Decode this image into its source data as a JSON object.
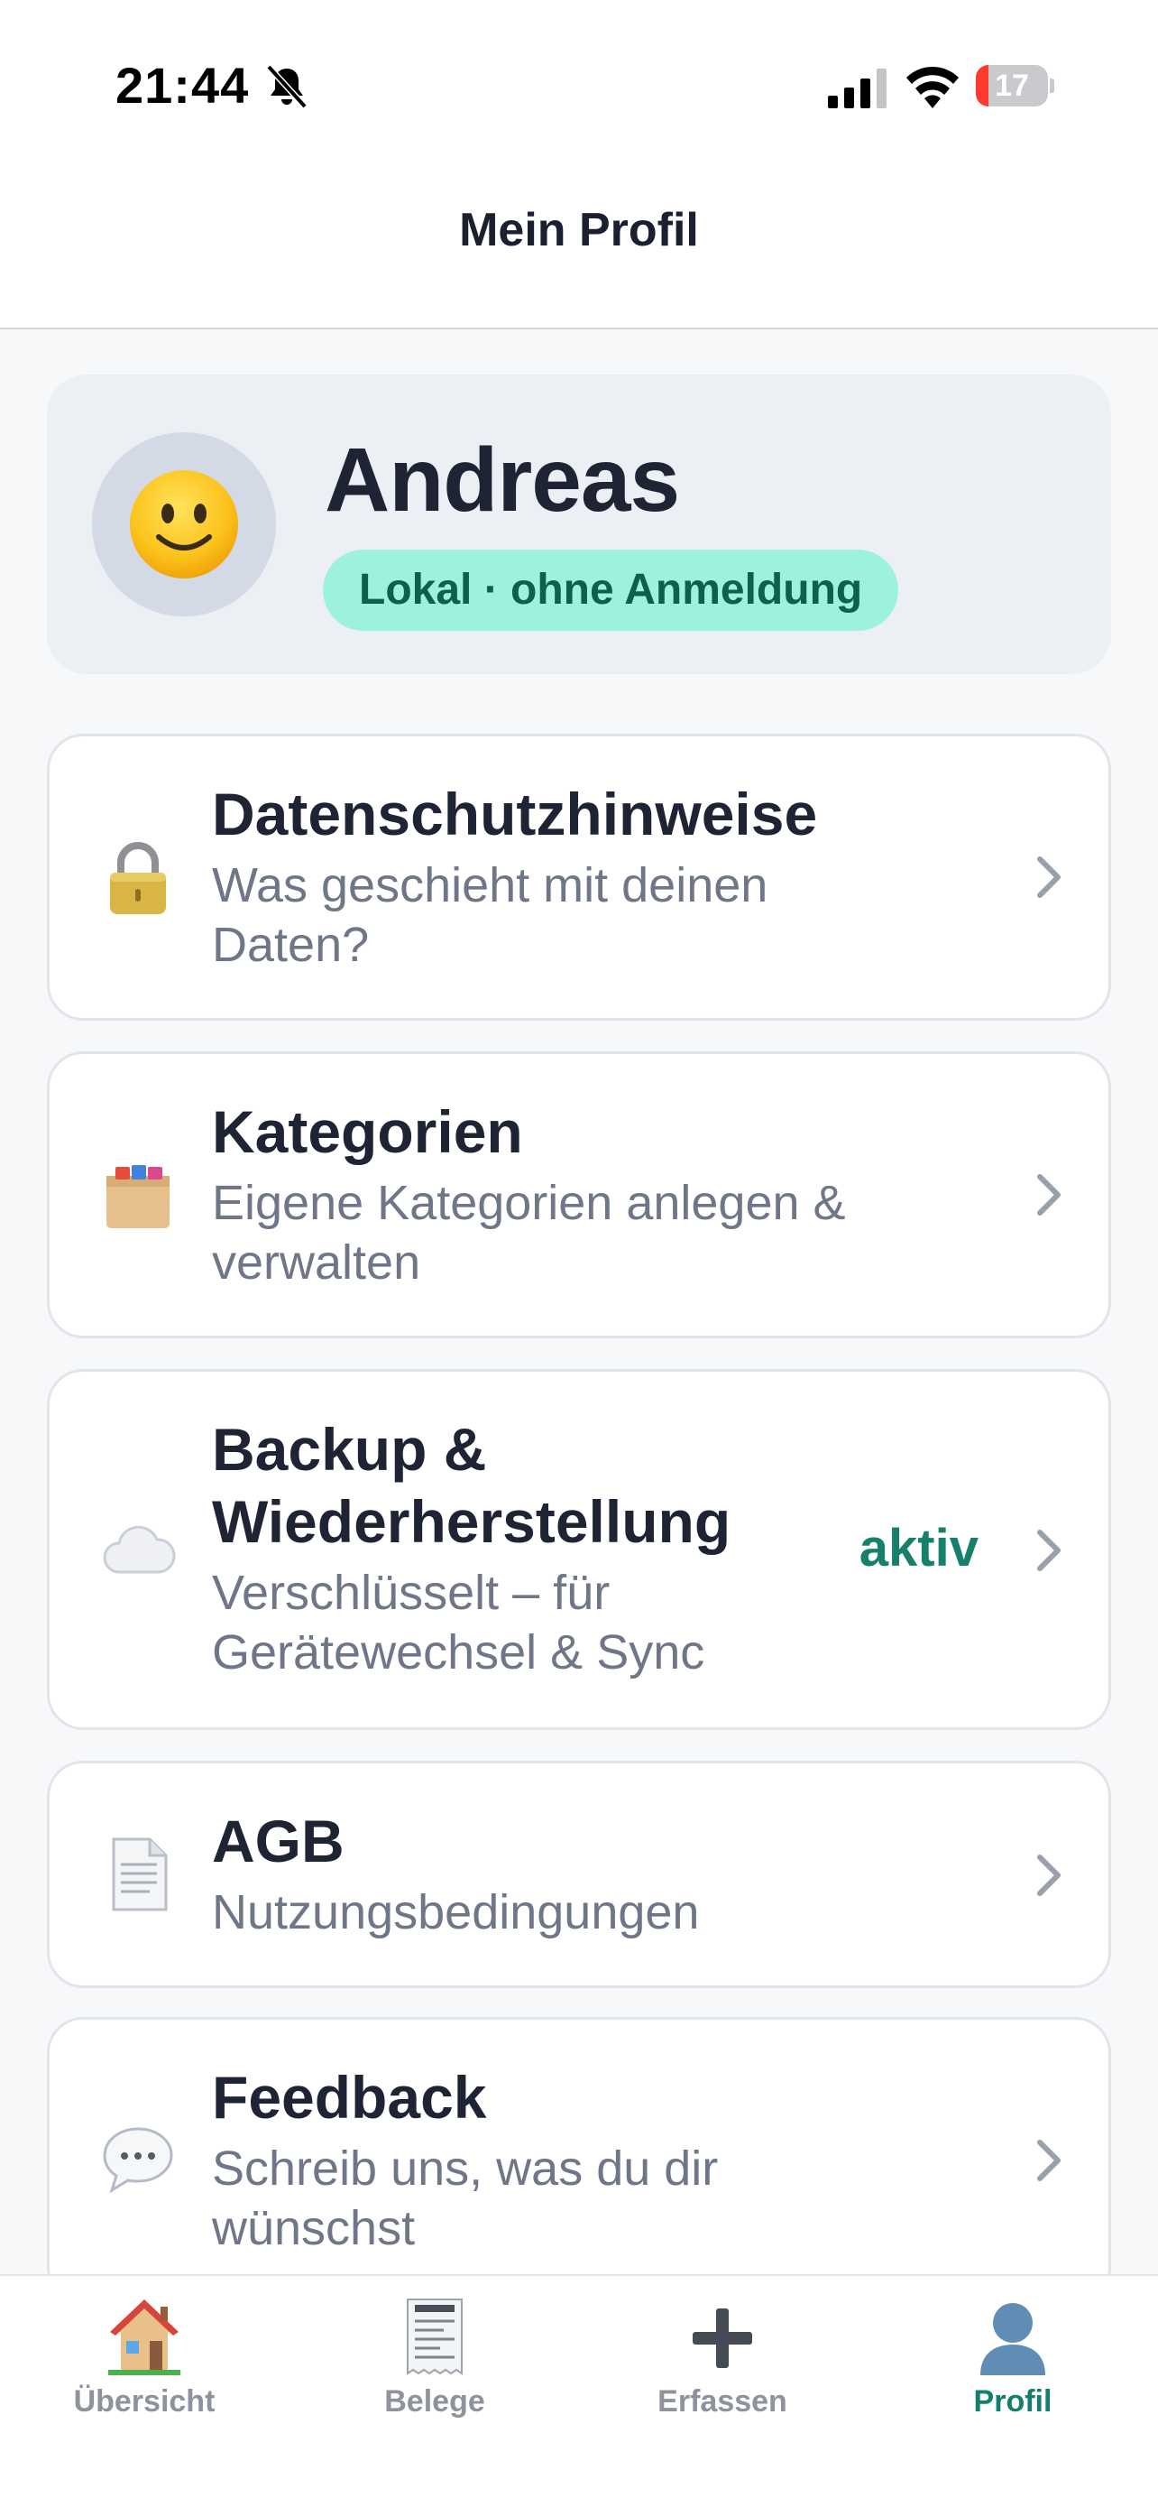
{
  "status_bar": {
    "time": "21:44",
    "battery_percent": "17",
    "battery_level": 0.17,
    "battery_color": "#ff3b30",
    "icons": [
      "bell-slash-icon",
      "cellular-signal-icon",
      "wifi-icon",
      "battery-icon"
    ]
  },
  "header": {
    "title": "Mein Profil"
  },
  "profile": {
    "avatar_icon": "smiling-face-icon",
    "name": "Andreas",
    "badge": "Lokal · ohne Anmeldung",
    "badge_color": "#9df2df"
  },
  "menu": {
    "items": [
      {
        "icon": "lock-icon",
        "title": "Datenschutzhinweise",
        "subtitle": "Was geschieht mit deinen Daten?"
      },
      {
        "icon": "card-file-box-icon",
        "title": "Kategorien",
        "subtitle": "Eigene Kategorien anlegen & verwalten"
      },
      {
        "icon": "cloud-icon",
        "title": "Backup & Wiederherstellung",
        "subtitle": "Verschlüsselt – für Gerätewechsel & Sync",
        "status": "aktiv"
      },
      {
        "icon": "document-icon",
        "title": "AGB",
        "subtitle": "Nutzungsbedingungen"
      },
      {
        "icon": "speech-bubble-icon",
        "title": "Feedback",
        "subtitle": "Schreib uns, was du dir wünschst"
      }
    ]
  },
  "tabs": [
    {
      "label": "Übersicht",
      "icon": "house-icon",
      "active": false
    },
    {
      "label": "Belege",
      "icon": "receipt-icon",
      "active": false
    },
    {
      "label": "Erfassen",
      "icon": "plus-icon",
      "active": false
    },
    {
      "label": "Profil",
      "icon": "person-silhouette-icon",
      "active": true
    }
  ],
  "colors": {
    "accent": "#14806b",
    "text_primary": "#1e2433",
    "text_secondary": "#6e7687",
    "tab_inactive": "#8d929c"
  }
}
